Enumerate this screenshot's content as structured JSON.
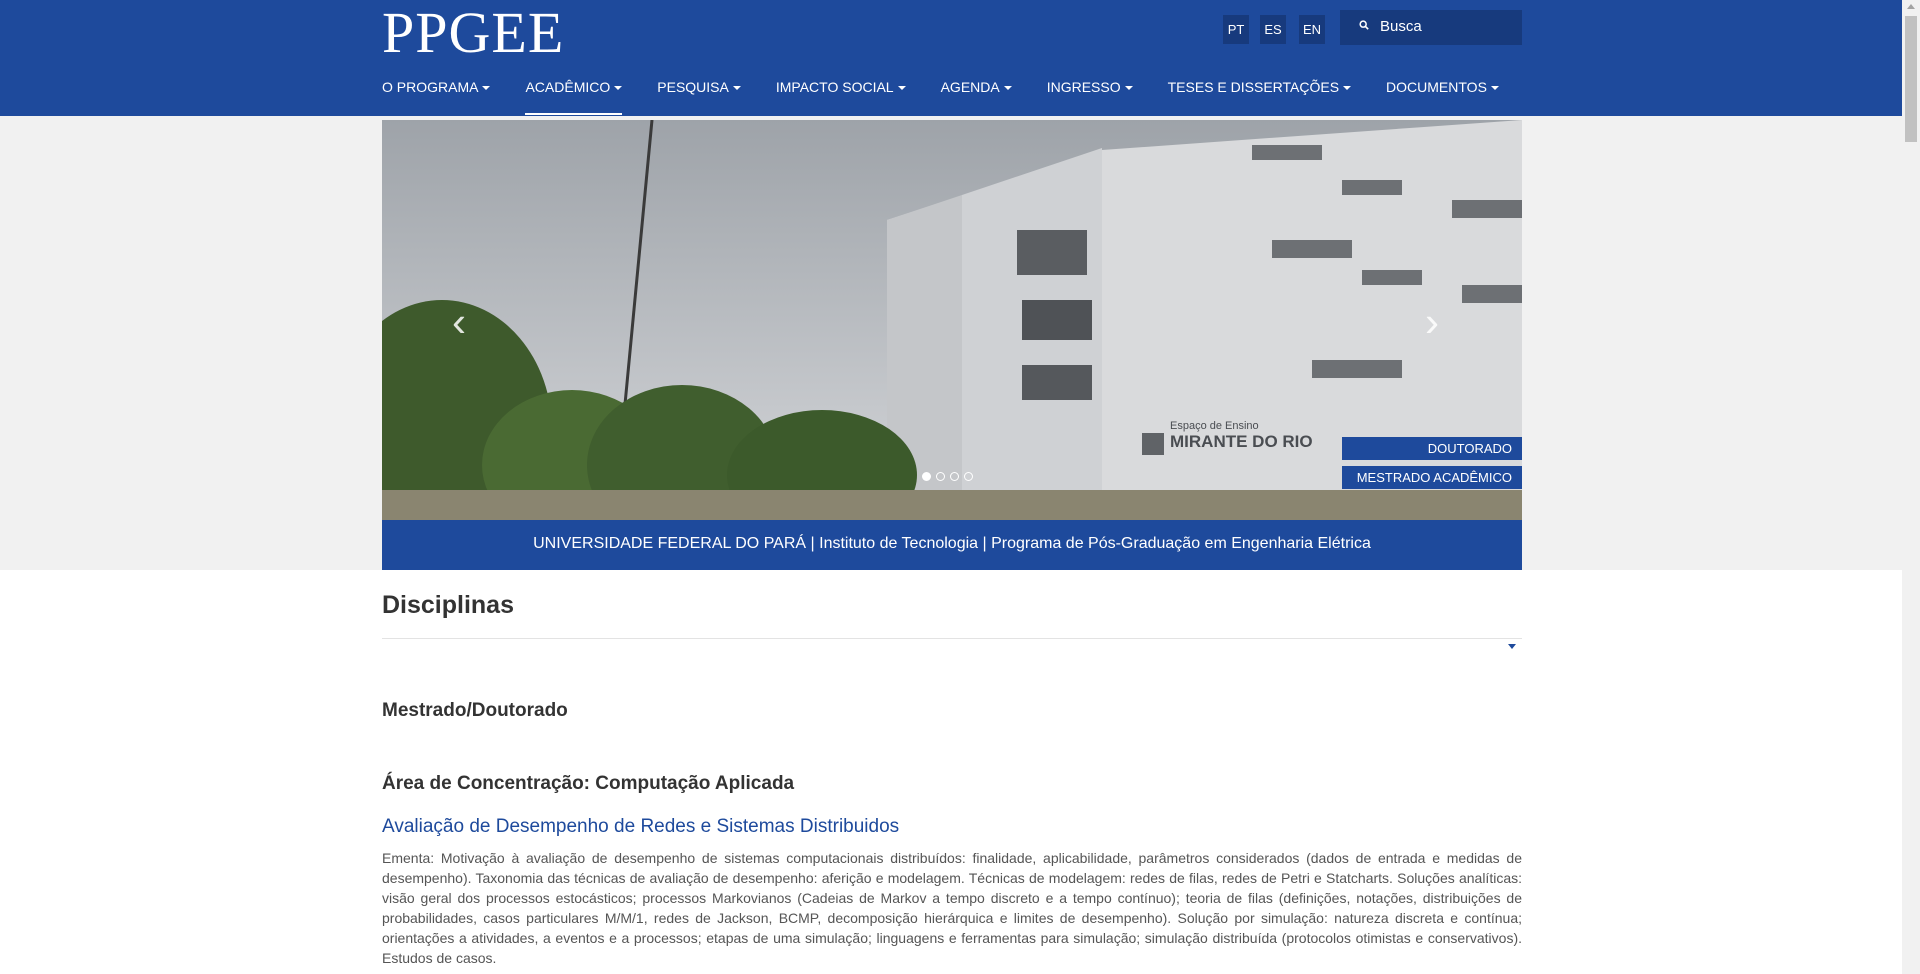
{
  "header": {
    "logo": "PPGEE",
    "languages": [
      "PT",
      "ES",
      "EN"
    ],
    "search_placeholder": "Busca"
  },
  "nav": {
    "items": [
      {
        "label": "O PROGRAMA"
      },
      {
        "label": "ACADÊMICO",
        "active": true
      },
      {
        "label": "PESQUISA"
      },
      {
        "label": "IMPACTO SOCIAL"
      },
      {
        "label": "AGENDA"
      },
      {
        "label": "INGRESSO"
      },
      {
        "label": "TESES E DISSERTAÇÕES"
      },
      {
        "label": "DOCUMENTOS"
      }
    ]
  },
  "carousel": {
    "building_sign_line1": "Espaço de Ensino",
    "building_sign_line2": "MIRANTE DO RIO",
    "buttons": [
      "DOUTORADO",
      "MESTRADO ACADÊMICO"
    ],
    "slide_count": 4,
    "active_slide": 1,
    "caption": "UNIVERSIDADE FEDERAL DO PARÁ | Instituto de Tecnologia | Programa de Pós-Graduação em Engenharia Elétrica"
  },
  "content": {
    "title": "Disciplinas",
    "level": "Mestrado/Doutorado",
    "area": "Área de Concentração: Computação Aplicada",
    "course_title": "Avaliação de Desempenho de Redes e Sistemas Distribuidos",
    "course_desc": "Ementa: Motivação à avaliação de desempenho de sistemas computacionais distribuídos: finalidade, aplicabilidade, parâmetros considerados (dados de entrada e medidas de desempenho). Taxonomia das técnicas de avaliação de desempenho: aferição e modelagem. Técnicas de modelagem: redes de filas, redes de Petri e Statcharts. Soluções analíticas: visão geral dos processos estocásticos; processos Markovianos (Cadeias de Markov a tempo discreto e a tempo contínuo); teoria de filas (definições, notações, distribuições de probabilidades, casos particulares M/M/1, redes de Jackson, BCMP, decomposição hierárquica e limites de desempenho). Solução por simulação: natureza discreta e contínua; orientações a atividades, a eventos e a processos; etapas de uma simulação; linguagens e ferramentas para simulação; simulação distribuída (protocolos otimistas e conservativos). Estudos de casos."
  },
  "colors": {
    "brand_blue": "#1e4a9c",
    "brand_dark": "#173a7d",
    "link_blue": "#1e4a9c"
  },
  "icons": [
    "search-icon",
    "chevron-left-icon",
    "chevron-right-icon",
    "caret-down-icon"
  ]
}
